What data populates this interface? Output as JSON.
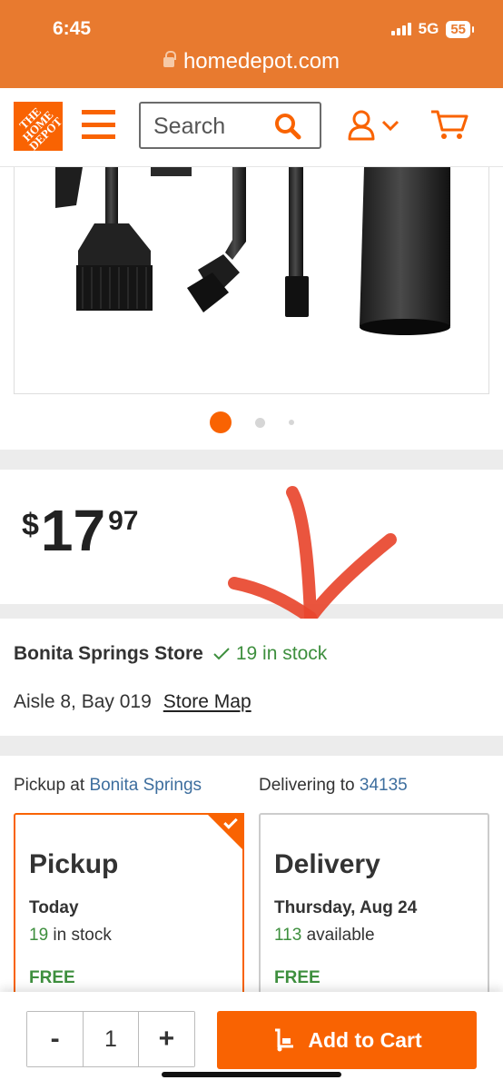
{
  "status_bar": {
    "time": "6:45",
    "network": "5G",
    "battery": "55"
  },
  "browser": {
    "url": "homedepot.com"
  },
  "header": {
    "logo_text": "THE HOME DEPOT",
    "search_placeholder": "Search",
    "icons": [
      "menu-icon",
      "search-icon",
      "account-icon",
      "chevron-down-icon",
      "cart-icon"
    ]
  },
  "gallery": {
    "image_count": 3,
    "active_index": 0
  },
  "price": {
    "symbol": "$",
    "dollars": "17",
    "cents": "97"
  },
  "store": {
    "name": "Bonita Springs Store",
    "stock": "19 in stock",
    "aisle": "Aisle 8, Bay 019",
    "map_link": "Store Map"
  },
  "fulfillment": {
    "pickup_prefix": "Pickup at",
    "pickup_store": "Bonita Springs",
    "delivery_prefix": "Delivering to",
    "delivery_zip": "34135",
    "options": [
      {
        "title": "Pickup",
        "when": "Today",
        "count": "19",
        "count_suffix": "in stock",
        "price": "FREE",
        "selected": true
      },
      {
        "title": "Delivery",
        "when": "Thursday, Aug 24",
        "count": "113",
        "count_suffix": "available",
        "price": "FREE",
        "selected": false
      }
    ]
  },
  "cart": {
    "decrement": "-",
    "quantity": "1",
    "increment": "+",
    "add_label": "Add to Cart"
  },
  "colors": {
    "brand_orange": "#f96302",
    "browser_orange": "#e87a2f",
    "stock_green": "#3e8f3e",
    "link_blue": "#3d6e9e",
    "annotation_red": "#e8472e"
  }
}
